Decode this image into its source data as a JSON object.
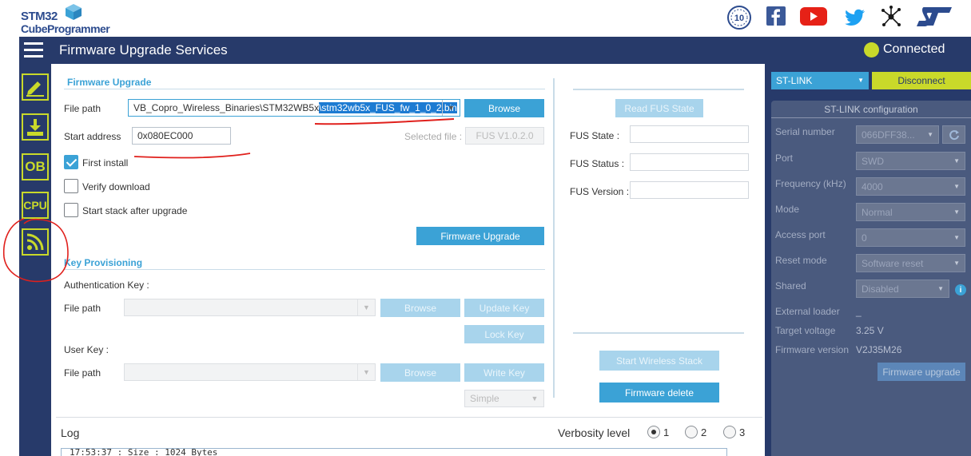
{
  "brand": {
    "line1": "STM32",
    "line2": "CubeProgrammer",
    "badge_text": "10"
  },
  "header": {
    "title": "Firmware Upgrade Services",
    "status": "Connected"
  },
  "sidebar": {
    "items": [
      {
        "name": "erasing-programming",
        "label": ""
      },
      {
        "name": "download",
        "label": ""
      },
      {
        "name": "option-bytes",
        "label": "OB"
      },
      {
        "name": "cpu",
        "label": "CPU"
      },
      {
        "name": "wireless",
        "label": ""
      }
    ]
  },
  "firmware_upgrade": {
    "title": "Firmware Upgrade",
    "file_path_label": "File path",
    "file_path_prefix": "VB_Copro_Wireless_Binaries\\STM32WB5x",
    "file_path_selected": "\\stm32wb5x_FUS_fw_1_0_2.bin",
    "browse_label": "Browse",
    "start_address_label": "Start address",
    "start_address_value": "0x080EC000",
    "selected_file_label": "Selected file :",
    "selected_file_value": "FUS V1.0.2.0",
    "first_install_label": "First install",
    "verify_download_label": "Verify download",
    "start_stack_label": "Start stack after upgrade",
    "upgrade_button": "Firmware Upgrade"
  },
  "key_provisioning": {
    "title": "Key Provisioning",
    "auth_key_label": "Authentication Key :",
    "file_path_label": "File path",
    "browse_label": "Browse",
    "update_key_label": "Update Key",
    "lock_key_label": "Lock Key",
    "user_key_label": "User Key :",
    "file_path2_label": "File path",
    "browse2_label": "Browse",
    "write_key_label": "Write Key",
    "key_type_value": "Simple"
  },
  "fus": {
    "read_state_button": "Read FUS State",
    "state_label": "FUS State :",
    "status_label": "FUS Status :",
    "version_label": "FUS Version :",
    "start_stack_button": "Start Wireless Stack",
    "delete_button": "Firmware delete"
  },
  "log": {
    "title": "Log",
    "verbosity_label": "Verbosity level",
    "levels": [
      "1",
      "2",
      "3"
    ],
    "selected_level": "1",
    "line": "17:53:37 : Size : 1024 Bytes"
  },
  "stlink": {
    "probe_select": "ST-LINK",
    "disconnect_button": "Disconnect",
    "config_title": "ST-LINK configuration",
    "serial_label": "Serial number",
    "serial_value": "066DFF38...",
    "port_label": "Port",
    "port_value": "SWD",
    "frequency_label": "Frequency (kHz)",
    "frequency_value": "4000",
    "mode_label": "Mode",
    "mode_value": "Normal",
    "access_port_label": "Access port",
    "access_port_value": "0",
    "reset_mode_label": "Reset mode",
    "reset_mode_value": "Software reset",
    "shared_label": "Shared",
    "shared_value": "Disabled",
    "external_loader_label": "External loader",
    "external_loader_value": "_",
    "target_voltage_label": "Target voltage",
    "target_voltage_value": "3.25 V",
    "firmware_version_label": "Firmware version",
    "firmware_version_value": "V2J35M26",
    "firmware_upgrade_button": "Firmware upgrade"
  },
  "colors": {
    "navy": "#273a6a",
    "accent": "#3ba2d6",
    "lime": "#c9d92a",
    "annotation": "#e0201c"
  }
}
